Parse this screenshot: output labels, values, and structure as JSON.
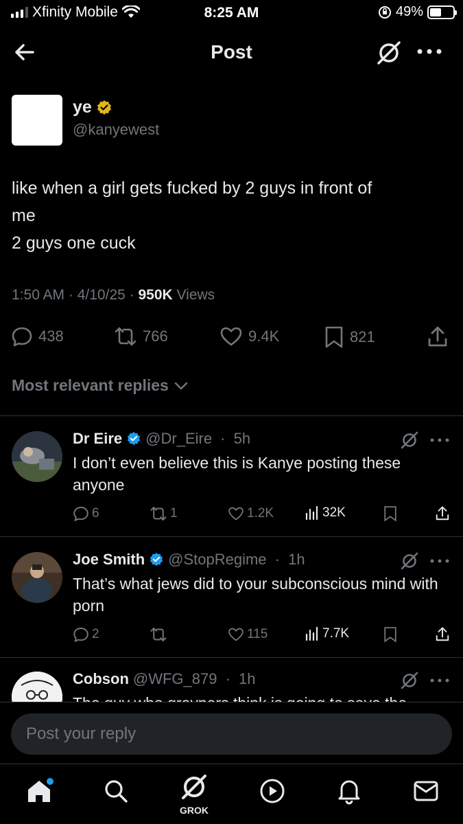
{
  "status_bar": {
    "carrier": "Xfinity Mobile",
    "time": "8:25 AM",
    "battery_percent": "49%",
    "battery_level": 0.49
  },
  "header": {
    "title": "Post",
    "icons": [
      "back-arrow-icon",
      "grok-icon",
      "more-icon"
    ]
  },
  "post": {
    "author_name": "ye",
    "author_handle": "@kanyewest",
    "verified_badge_color": "#e2b719",
    "text_lines": [
      "like when a girl gets fucked by 2 guys in front of",
      "me",
      "2 guys one cuck"
    ],
    "time": "1:50 AM",
    "date": "4/10/25",
    "views_count": "950K",
    "views_label": "Views",
    "separator": " · ",
    "actions": {
      "replies": "438",
      "reposts": "766",
      "likes": "9.4K",
      "bookmarks": "821"
    }
  },
  "sort": {
    "label": "Most relevant replies"
  },
  "replies": [
    {
      "name": "Dr Eire",
      "handle": "@Dr_Eire",
      "time": "5h",
      "verified_color": "#1d9bf0",
      "text": "I don’t even believe this is Kanye posting these anyone",
      "replies": "6",
      "reposts": "1",
      "likes": "1.2K",
      "views": "32K"
    },
    {
      "name": "Joe Smith",
      "handle": "@StopRegime",
      "time": "1h",
      "verified_color": "#1d9bf0",
      "text": "That’s what jews did to your subconscious mind with porn",
      "replies": "2",
      "reposts": "",
      "likes": "115",
      "views": "7.7K"
    },
    {
      "name": "Cobson",
      "handle": "@WFG_879",
      "time": "1h",
      "text": "The guy who groypers think is going to save the"
    }
  ],
  "reply_box": {
    "placeholder": "Post your reply"
  },
  "bottom_nav": {
    "grok_label": "GROK",
    "home_badge_color": "#1d9bf0"
  }
}
